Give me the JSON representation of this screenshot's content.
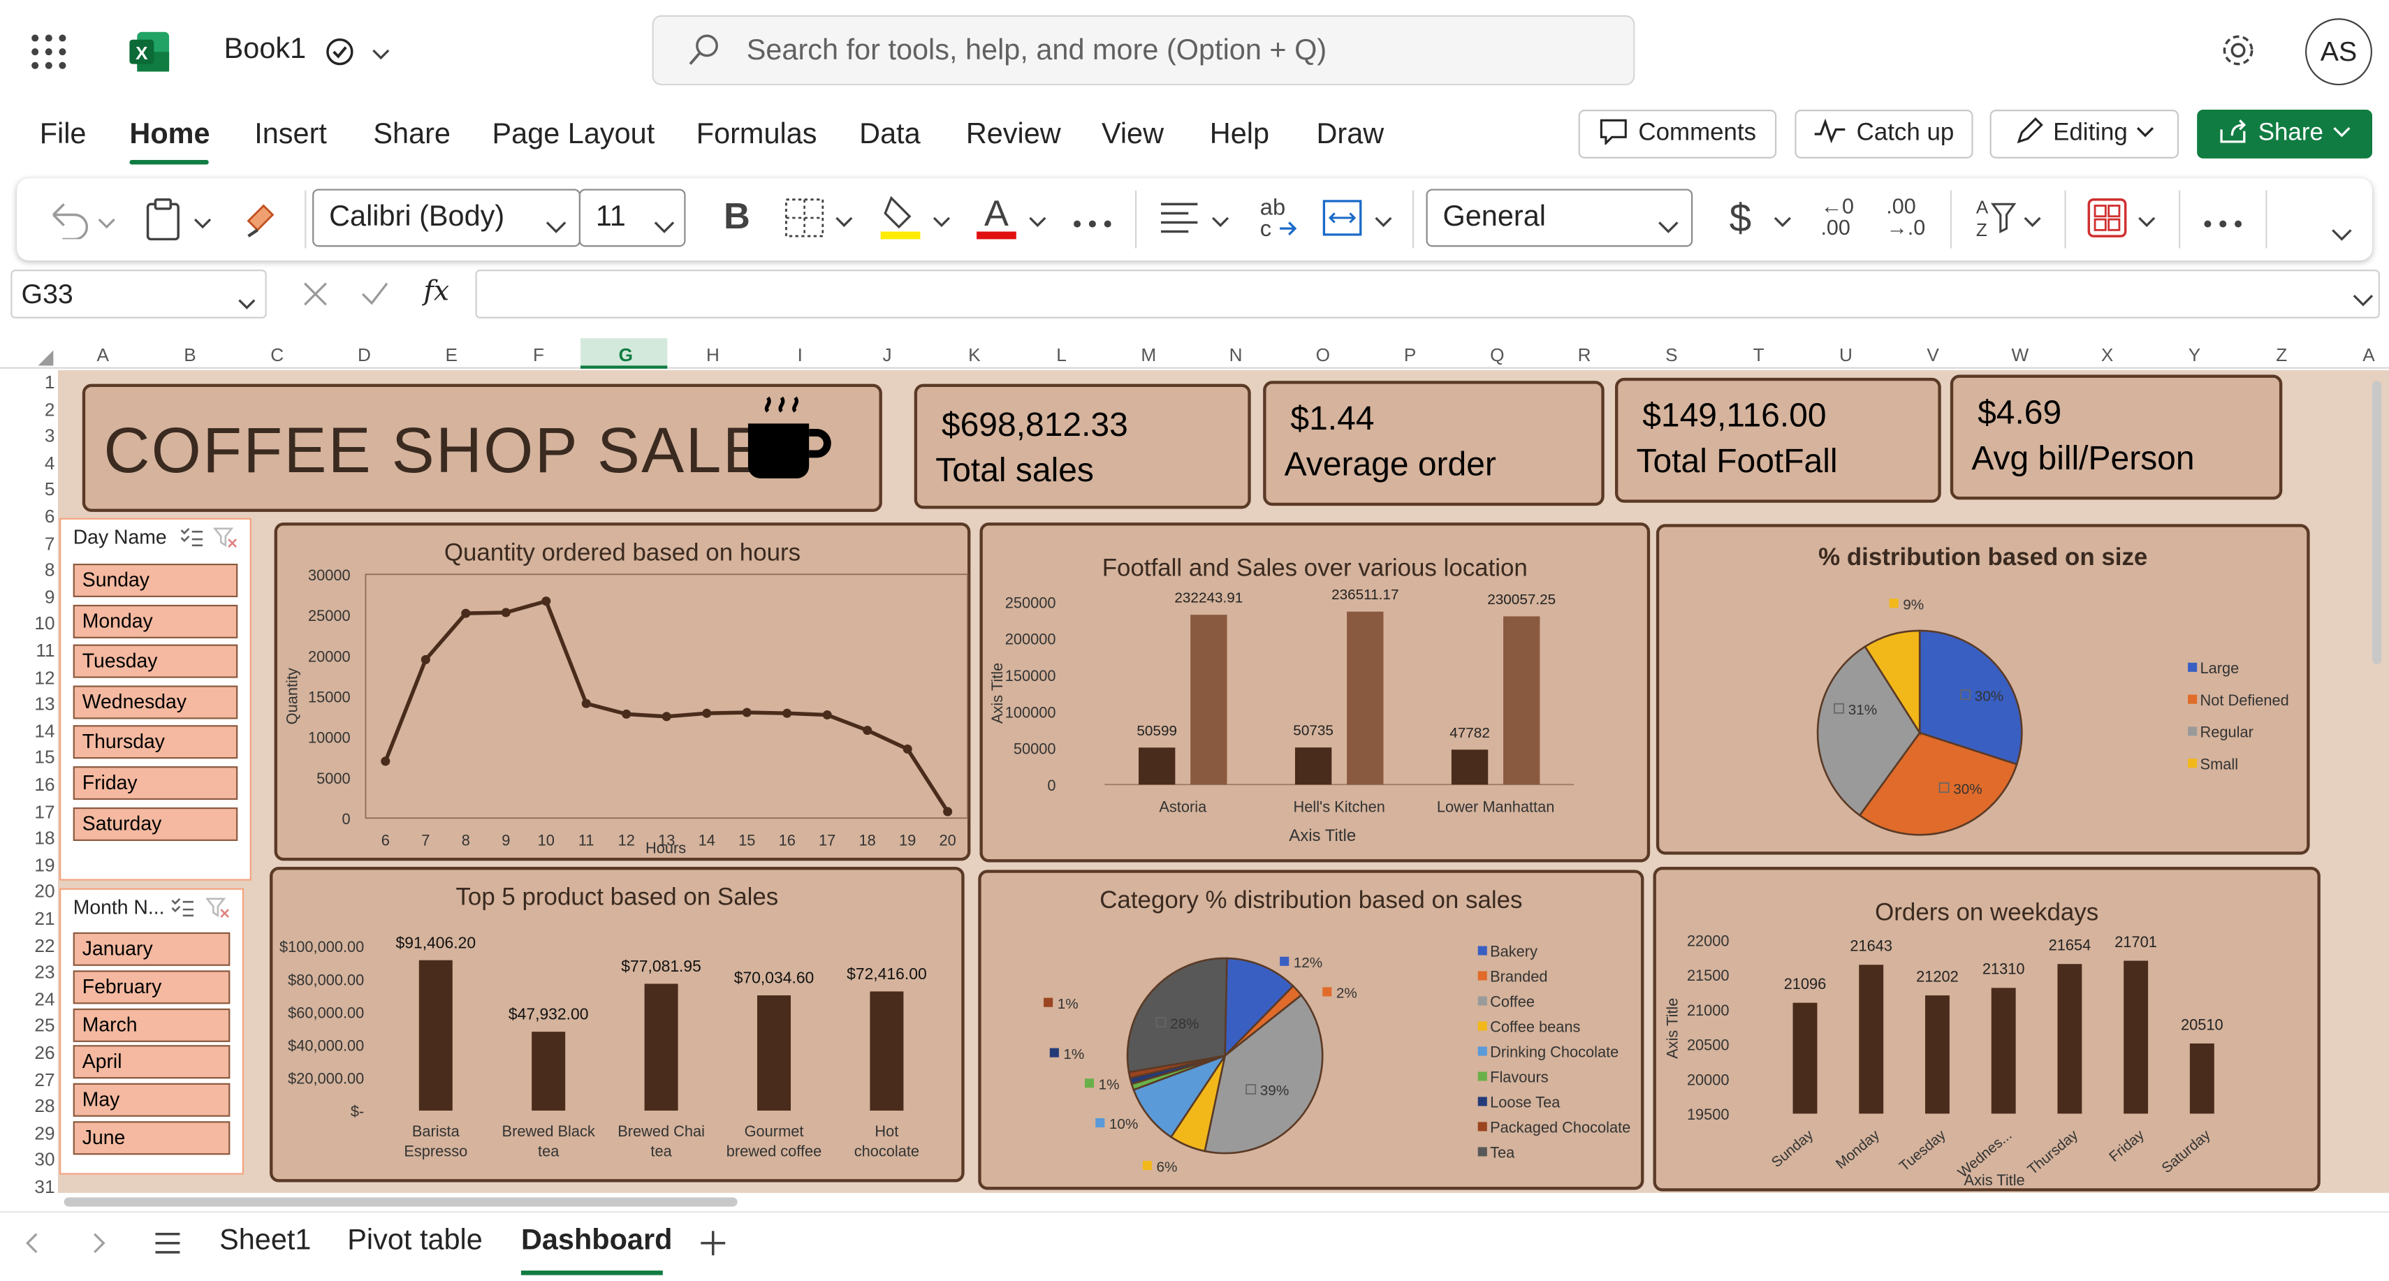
{
  "app": {
    "doc_title": "Book1",
    "search_placeholder": "Search for tools, help, and more (Option + Q)",
    "avatar": "AS"
  },
  "menu": [
    "File",
    "Home",
    "Insert",
    "Share",
    "Page Layout",
    "Formulas",
    "Data",
    "Review",
    "View",
    "Help",
    "Draw"
  ],
  "top_buttons": {
    "comments": "Comments",
    "catchup": "Catch up",
    "editing": "Editing",
    "share": "Share"
  },
  "ribbon": {
    "font": "Calibri (Body)",
    "size": "11",
    "format": "General",
    "bold": "B",
    "dollar": "$",
    "inc": "←0\n.00",
    "dec": ".00\n→.0"
  },
  "formula": {
    "cellref": "G33",
    "fx": "fx"
  },
  "columns": [
    "A",
    "B",
    "C",
    "D",
    "E",
    "F",
    "G",
    "H",
    "I",
    "J",
    "K",
    "L",
    "M",
    "N",
    "O",
    "P",
    "Q",
    "R",
    "S",
    "T",
    "U",
    "V",
    "W",
    "X",
    "Y",
    "Z",
    "A"
  ],
  "rows": [
    "1",
    "2",
    "3",
    "4",
    "5",
    "6",
    "7",
    "8",
    "9",
    "10",
    "11",
    "12",
    "13",
    "14",
    "15",
    "16",
    "17",
    "18",
    "19",
    "20",
    "21",
    "22",
    "23",
    "24",
    "25",
    "26",
    "27",
    "28",
    "29",
    "30",
    "31"
  ],
  "dashboard": {
    "title": "COFFEE SHOP SALES",
    "kpis": [
      {
        "value": "$698,812.33",
        "label": "Total sales"
      },
      {
        "value": "$1.44",
        "label": "Average order"
      },
      {
        "value": "$149,116.00",
        "label": "Total FootFall"
      },
      {
        "value": "$4.69",
        "label": "Avg bill/Person"
      }
    ]
  },
  "slicer_day": {
    "title": "Day Name",
    "items": [
      "Sunday",
      "Monday",
      "Tuesday",
      "Wednesday",
      "Thursday",
      "Friday",
      "Saturday"
    ]
  },
  "slicer_month": {
    "title": "Month N...",
    "items": [
      "January",
      "February",
      "March",
      "April",
      "May",
      "June"
    ]
  },
  "chart_data": [
    {
      "type": "line",
      "title": "Quantity ordered based on hours",
      "xlabel": "Hours",
      "ylabel": "Quantity",
      "x": [
        6,
        7,
        8,
        9,
        10,
        11,
        12,
        13,
        14,
        15,
        16,
        17,
        18,
        19,
        20
      ],
      "values": [
        7000,
        19500,
        25200,
        25300,
        26700,
        14100,
        12800,
        12500,
        12900,
        13000,
        12900,
        12700,
        10800,
        8500,
        800
      ],
      "ylim": [
        0,
        30000
      ],
      "yticks": [
        "30000",
        "25000",
        "20000",
        "15000",
        "10000",
        "5000",
        "0"
      ],
      "color": "#4a2c1c"
    },
    {
      "type": "bar",
      "title": "Footfall and Sales over various location",
      "xlabel": "Axis Title",
      "ylabel": "Axis Title",
      "categories": [
        "Astoria",
        "Hell's Kitchen",
        "Lower Manhattan"
      ],
      "series": [
        {
          "values": [
            50599,
            50735,
            47782
          ],
          "labels": [
            "50599",
            "50735",
            "47782"
          ],
          "color": "#4a2c1c"
        },
        {
          "values": [
            232243.91,
            236511.17,
            230057.25
          ],
          "labels": [
            "232243.91",
            "236511.17",
            "230057.25"
          ],
          "color": "#8a5a40"
        }
      ],
      "ylim": [
        0,
        250000
      ],
      "yticks": [
        "250000",
        "200000",
        "150000",
        "100000",
        "50000",
        "0"
      ]
    },
    {
      "type": "pie",
      "title": "% distribution based on size",
      "labels": [
        "Large",
        "Not Defiened",
        "Regular",
        "Small"
      ],
      "values": [
        30,
        30,
        31,
        9
      ],
      "slice_labels": [
        "30%",
        "30%",
        "31%",
        "9%"
      ],
      "colors": [
        "#3a5fc2",
        "#e06b2a",
        "#9a9a9a",
        "#f2b81a"
      ]
    },
    {
      "type": "bar",
      "title": "Top 5 product based on Sales",
      "categories": [
        "Barista Espresso",
        "Brewed Black tea",
        "Brewed Chai tea",
        "Gourmet brewed coffee",
        "Hot chocolate"
      ],
      "values": [
        91406.2,
        47932,
        77081.95,
        70034.6,
        72416
      ],
      "labels": [
        "$91,406.20",
        "$47,932.00",
        "$77,081.95",
        "$70,034.60",
        "$72,416.00"
      ],
      "ylim": [
        0,
        100000
      ],
      "yticks": [
        "$100,000.00",
        "$80,000.00",
        "$60,000.00",
        "$40,000.00",
        "$20,000.00",
        "$-"
      ],
      "color": "#4a2c1c"
    },
    {
      "type": "pie",
      "title": "Category % distribution based on sales",
      "labels": [
        "Bakery",
        "Branded",
        "Coffee",
        "Coffee beans",
        "Drinking Chocolate",
        "Flavours",
        "Loose Tea",
        "Packaged Chocolate",
        "Tea"
      ],
      "values": [
        12,
        2,
        39,
        6,
        10,
        1,
        1,
        1,
        28
      ],
      "slice_labels": [
        "12%",
        "2%",
        "39%",
        "6%",
        "10%",
        "1%",
        "1%",
        "1%",
        "28%"
      ],
      "colors": [
        "#3a5fc2",
        "#e06b2a",
        "#9a9a9a",
        "#f2b81a",
        "#5a9ad8",
        "#6ab04a",
        "#243a78",
        "#9a4420",
        "#585858"
      ]
    },
    {
      "type": "bar",
      "title": "Orders on weekdays",
      "xlabel": "Axis Title",
      "ylabel": "Axis Title",
      "categories": [
        "Sunday",
        "Monday",
        "Tuesday",
        "Wednes...",
        "Thursday",
        "Friday",
        "Saturday"
      ],
      "values": [
        21096,
        21643,
        21202,
        21310,
        21654,
        21701,
        20510
      ],
      "labels": [
        "21096",
        "21643",
        "21202",
        "21310",
        "21654",
        "21701",
        "20510"
      ],
      "ylim": [
        19500,
        22000
      ],
      "yticks": [
        "22000",
        "21500",
        "21000",
        "20500",
        "20000",
        "19500"
      ],
      "color": "#4a2c1c"
    }
  ],
  "sheets": [
    "Sheet1",
    "Pivot table",
    "Dashboard"
  ],
  "colors": {
    "excel_green": "#107c41",
    "card": "#d5b39c",
    "border": "#5a3a26",
    "dark": "#4a2c1c"
  }
}
